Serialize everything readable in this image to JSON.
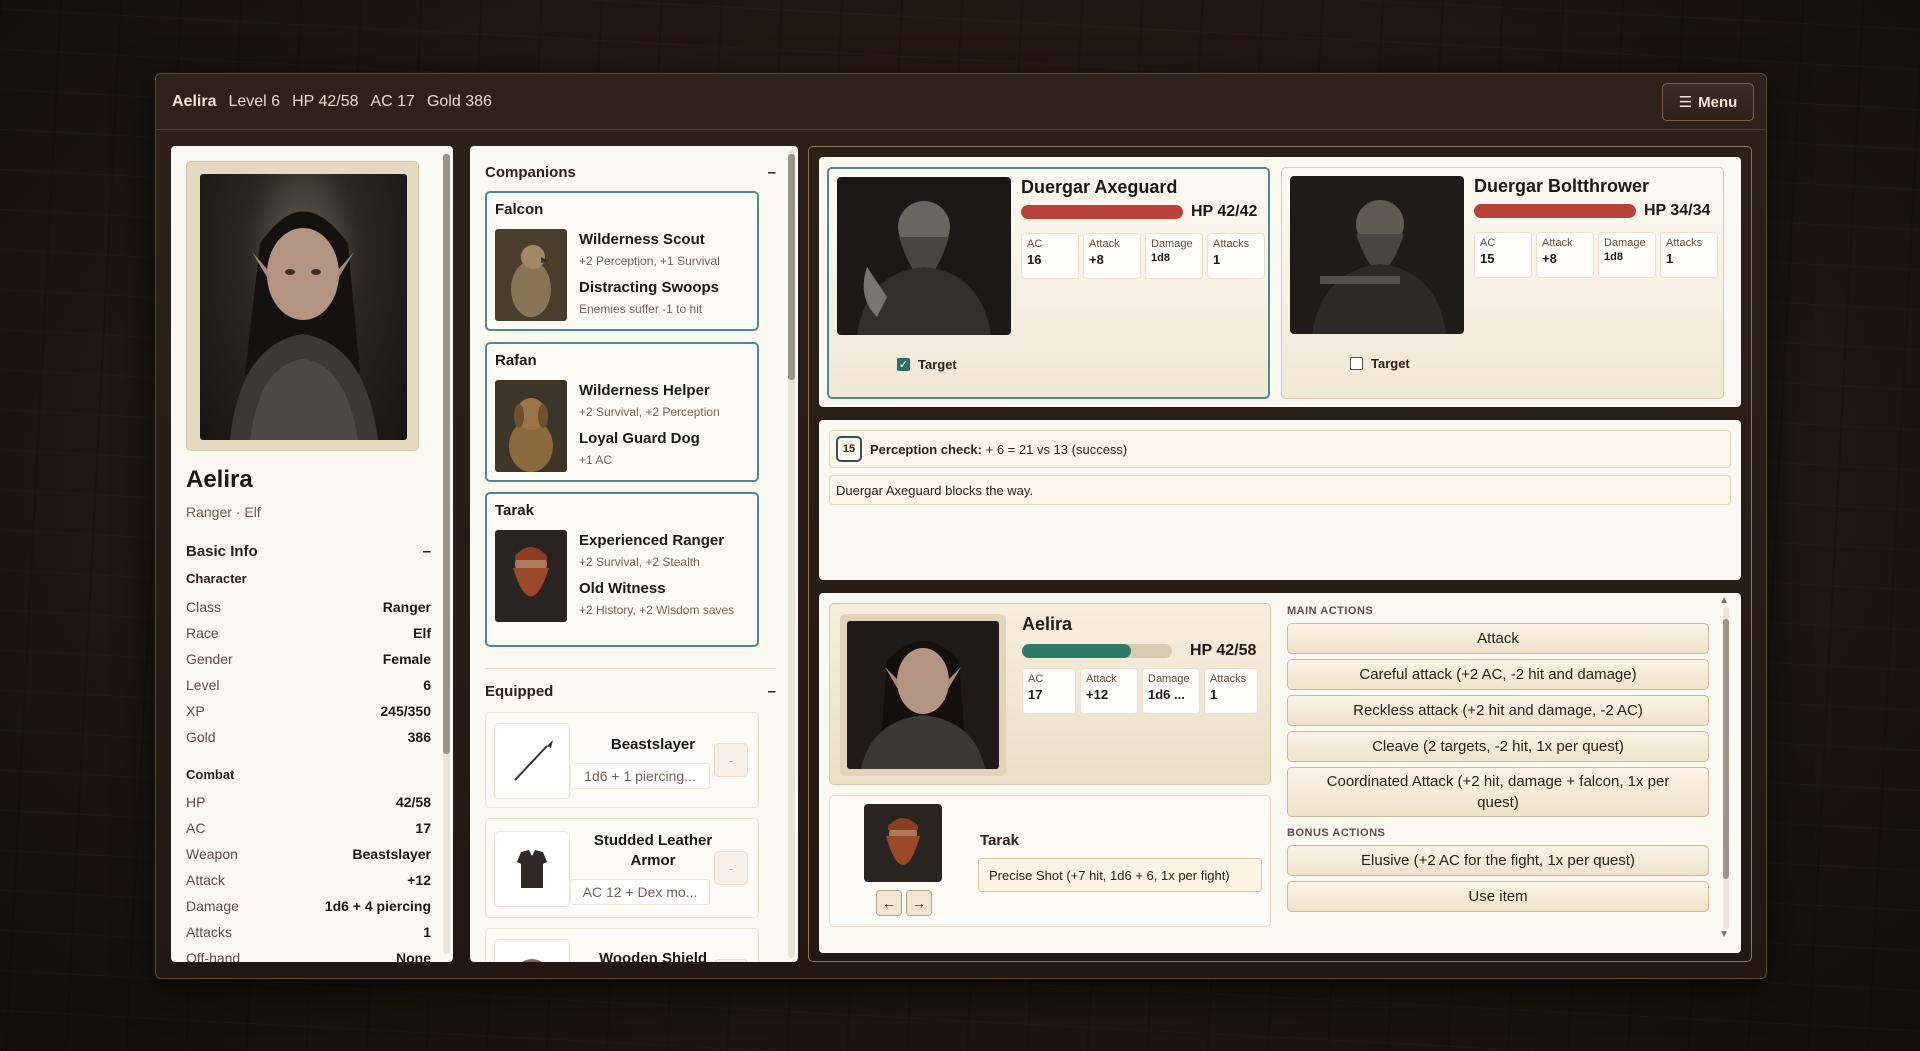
{
  "topbar": {
    "name": "Aelira",
    "level": "Level 6",
    "hp": "HP 42/58",
    "ac": "AC 17",
    "gold": "Gold 386",
    "menu_label": "Menu"
  },
  "character": {
    "name": "Aelira",
    "subtitle": "Ranger · Elf",
    "basic_info_title": "Basic Info",
    "collapse_glyph": "–",
    "character_subhead": "Character",
    "character_rows": [
      {
        "k": "Class",
        "v": "Ranger"
      },
      {
        "k": "Race",
        "v": "Elf"
      },
      {
        "k": "Gender",
        "v": "Female"
      },
      {
        "k": "Level",
        "v": "6"
      },
      {
        "k": "XP",
        "v": "245/350"
      },
      {
        "k": "Gold",
        "v": "386"
      }
    ],
    "combat_subhead": "Combat",
    "combat_rows": [
      {
        "k": "HP",
        "v": "42/58"
      },
      {
        "k": "AC",
        "v": "17"
      },
      {
        "k": "Weapon",
        "v": "Beastslayer"
      },
      {
        "k": "Attack",
        "v": "+12"
      },
      {
        "k": "Damage",
        "v": "1d6 + 4 piercing"
      },
      {
        "k": "Attacks",
        "v": "1"
      },
      {
        "k": "Off-hand",
        "v": "None"
      }
    ]
  },
  "companions": {
    "title": "Companions",
    "collapse_glyph": "–",
    "items": [
      {
        "name": "Falcon",
        "a1": "Wilderness Scout",
        "d1": "+2 Perception, +1 Survival",
        "a2": "Distracting Swoops",
        "d2": "Enemies suffer -1 to hit"
      },
      {
        "name": "Rafan",
        "a1": "Wilderness Helper",
        "d1": "+2 Survival, +2 Perception",
        "a2": "Loyal Guard Dog",
        "d2": "+1 AC"
      },
      {
        "name": "Tarak",
        "a1": "Experienced Ranger",
        "d1": "+2 Survival, +2 Stealth",
        "a2": "Old Witness",
        "d2": "+2 History, +2 Wisdom saves"
      }
    ]
  },
  "equipped": {
    "title": "Equipped",
    "collapse_glyph": "–",
    "remove_glyph": "-",
    "items": [
      {
        "name": "Beastslayer",
        "stat": "1d6 + 1 piercing...",
        "icon": "spear-icon"
      },
      {
        "name": "Studded Leather Armor",
        "stat": "AC 12 + Dex mo...",
        "icon": "armor-icon"
      },
      {
        "name": "Wooden Shield",
        "stat": "",
        "icon": "shield-icon"
      }
    ]
  },
  "enemies": [
    {
      "name": "Duergar Axeguard",
      "hp": "HP 42/42",
      "hp_fraction": 1.0,
      "ac": "16",
      "attack": "+8",
      "damage": "1d8",
      "attacks": "1",
      "target": true
    },
    {
      "name": "Duergar Boltthrower",
      "hp": "HP 34/34",
      "hp_fraction": 1.0,
      "ac": "15",
      "attack": "+8",
      "damage": "1d8",
      "attacks": "1",
      "target": false
    }
  ],
  "stat_labels": {
    "ac": "AC",
    "attack": "Attack",
    "damage": "Damage",
    "attacks": "Attacks"
  },
  "target_label": "Target",
  "log": {
    "die": "15",
    "check_label": "Perception check:",
    "check_text": "+ 6 = 21 vs 13 (success)",
    "line2": "Duergar Axeguard blocks the way."
  },
  "player": {
    "name": "Aelira",
    "hp": "HP 42/58",
    "hp_fraction": 0.724,
    "ac": "17",
    "attack": "+12",
    "damage": "1d6 ...",
    "attacks": "1"
  },
  "companion_turn": {
    "name": "Tarak",
    "action": "Precise Shot (+7 hit, 1d6 + 6, 1x per fight)",
    "prev": "←",
    "next": "→"
  },
  "actions": {
    "main_head": "MAIN ACTIONS",
    "main": [
      "Attack",
      "Careful attack (+2 AC, -2 hit and damage)",
      "Reckless attack (+2 hit and damage, -2 AC)",
      "Cleave (2 targets, -2 hit, 1x per quest)",
      "Coordinated Attack (+2 hit, damage + falcon, 1x per quest)"
    ],
    "bonus_head": "BONUS ACTIONS",
    "bonus": [
      "Elusive (+2 AC for the fight, 1x per quest)",
      "Use item"
    ]
  },
  "colors": {
    "enemy_hp": "#b8413a",
    "player_hp": "#2f7a68",
    "accent": "#4f8b86"
  }
}
